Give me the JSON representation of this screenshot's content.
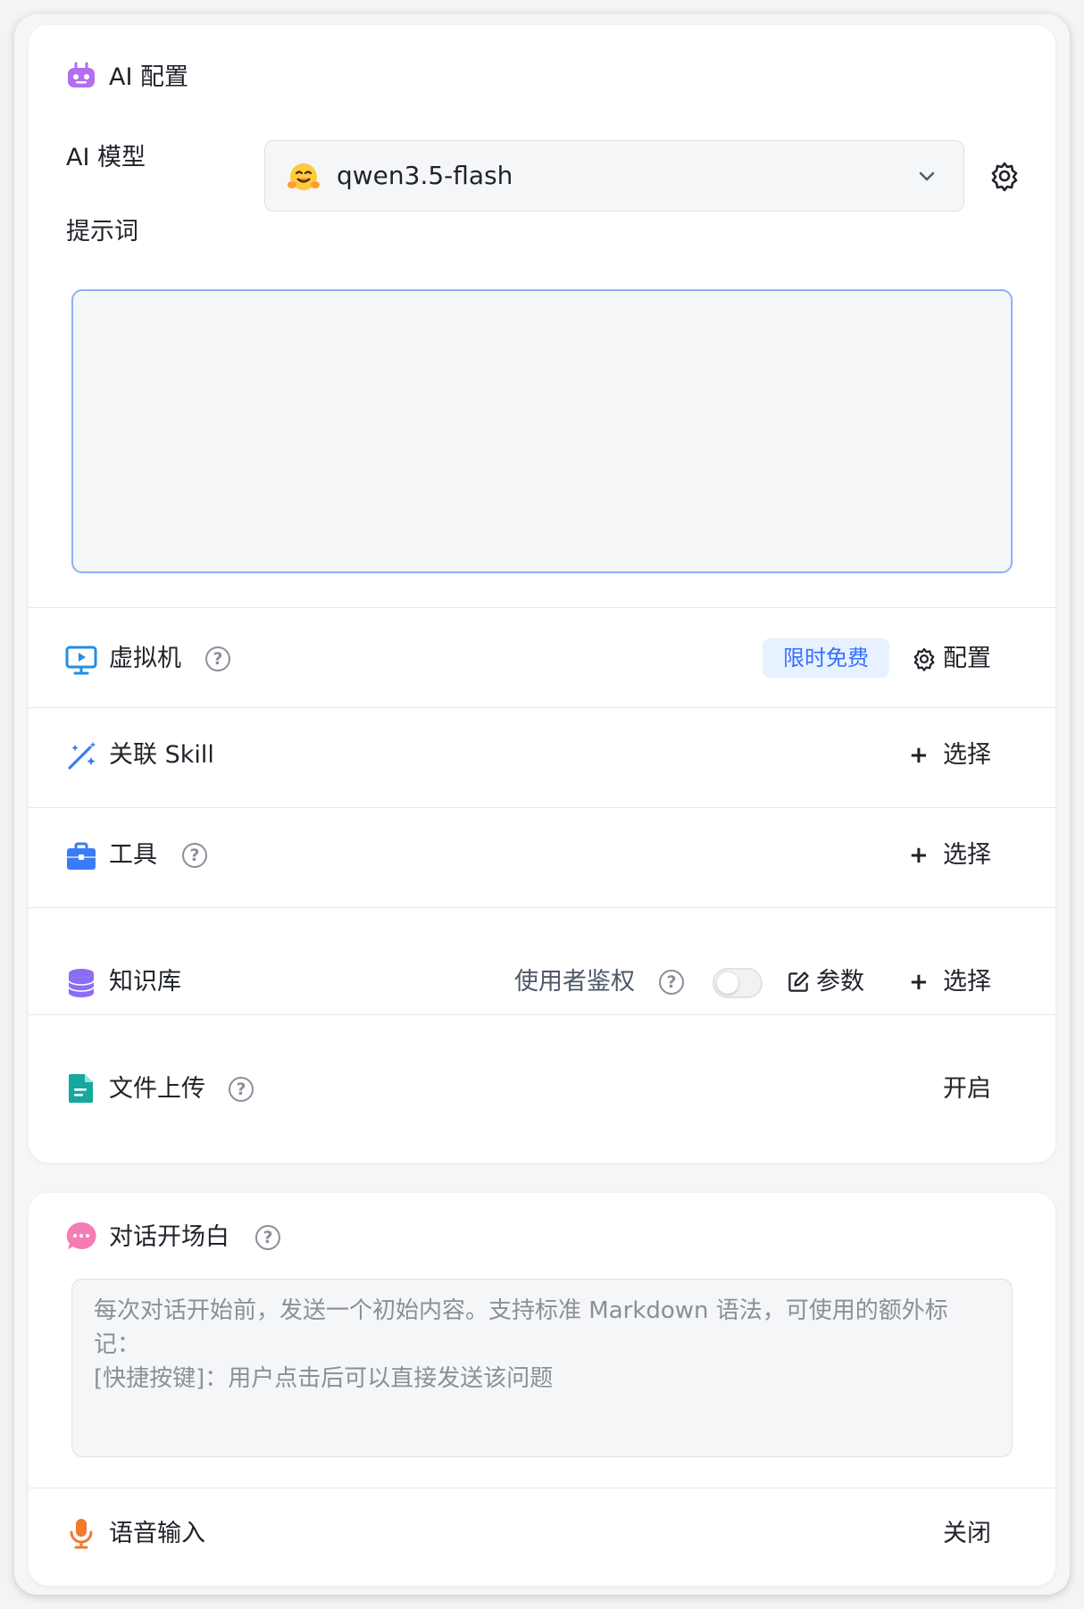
{
  "ai_config": {
    "title": "AI 配置",
    "model_label": "AI 模型",
    "model_value": "qwen3.5-flash",
    "prompt_label": "提示词",
    "prompt_value": ""
  },
  "virtual_machine": {
    "label": "虚拟机",
    "badge": "限时免费",
    "config_label": "配置"
  },
  "skill": {
    "label": "关联 Skill",
    "select_label": "选择"
  },
  "tools": {
    "label": "工具",
    "select_label": "选择"
  },
  "knowledge": {
    "label": "知识库",
    "auth_label": "使用者鉴权",
    "params_label": "参数",
    "select_label": "选择"
  },
  "file_upload": {
    "label": "文件上传",
    "status": "开启"
  },
  "opening": {
    "label": "对话开场白",
    "lines": [
      "每次对话开始前，发送一个初始内容。支持标准 Markdown 语法，可使用的额外标记：",
      "[快捷按键]：用户点击后可以直接发送该问题"
    ]
  },
  "voice_input": {
    "label": "语音输入",
    "status": "关闭"
  },
  "colors": {
    "accent_blue": "#3370ff",
    "robot_purple": "#b36ef0",
    "monitor_blue": "#1f8fe6",
    "tools_blue": "#3a7cf5",
    "db_purple": "#8b6cf5",
    "file_teal": "#14a89e",
    "chat_pink": "#f57cb5",
    "mic_orange": "#f07a2e"
  },
  "icons": [
    "robot-icon",
    "settings-gear-icon",
    "chevron-down-icon",
    "monitor-icon",
    "help-circle-icon",
    "magic-wand-icon",
    "toolbox-icon",
    "database-icon",
    "file-icon",
    "edit-icon",
    "chat-bubble-icon",
    "microphone-icon"
  ]
}
